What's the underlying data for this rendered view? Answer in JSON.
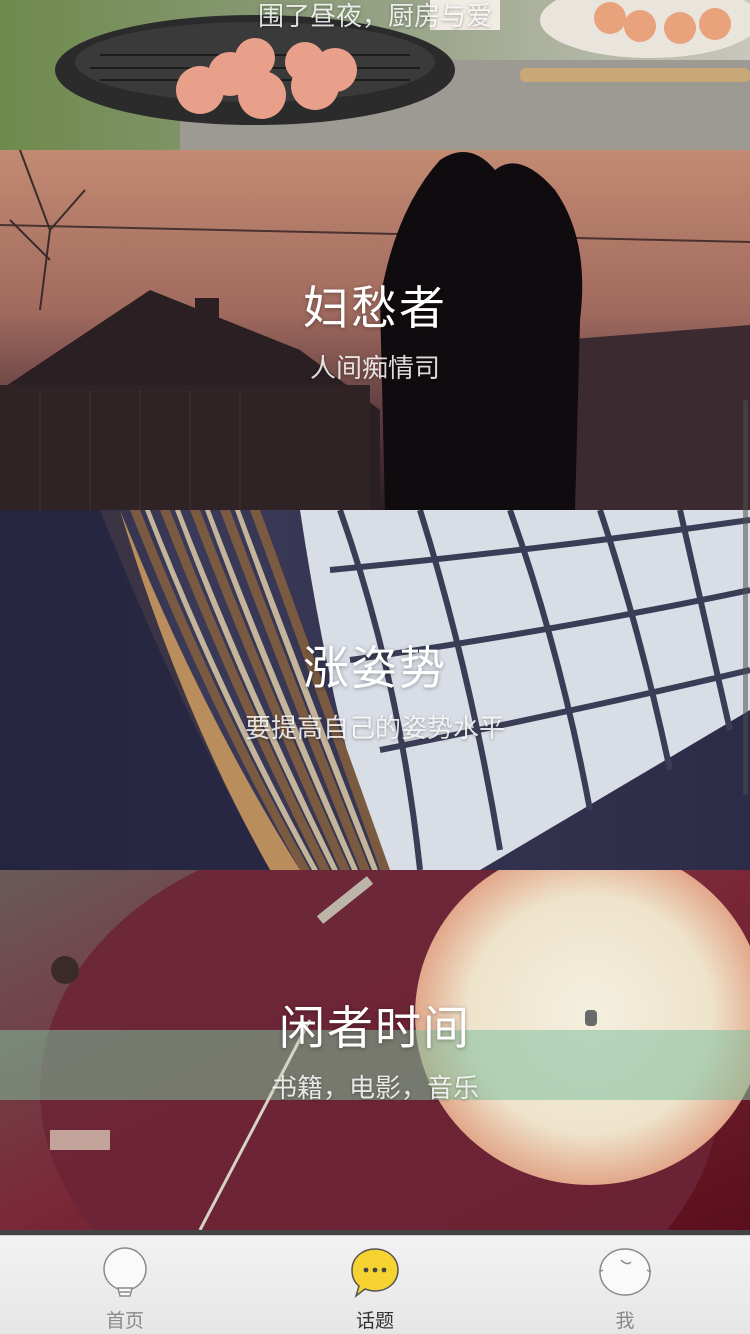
{
  "cards": [
    {
      "title": "",
      "subtitle": "围了昼夜，厨房与爱"
    },
    {
      "title": "妇愁者",
      "subtitle": "人间痴情司"
    },
    {
      "title": "涨姿势",
      "subtitle": "要提高自己的姿势水平"
    },
    {
      "title": "闲者时间",
      "subtitle": "书籍，电影，音乐"
    }
  ],
  "tabbar": {
    "items": [
      {
        "label": "首页",
        "icon": "lightbulb-icon",
        "active": false
      },
      {
        "label": "话题",
        "icon": "chat-bubble-icon",
        "active": true
      },
      {
        "label": "我",
        "icon": "face-icon",
        "active": false
      }
    ],
    "active_color": "#f7d331"
  }
}
